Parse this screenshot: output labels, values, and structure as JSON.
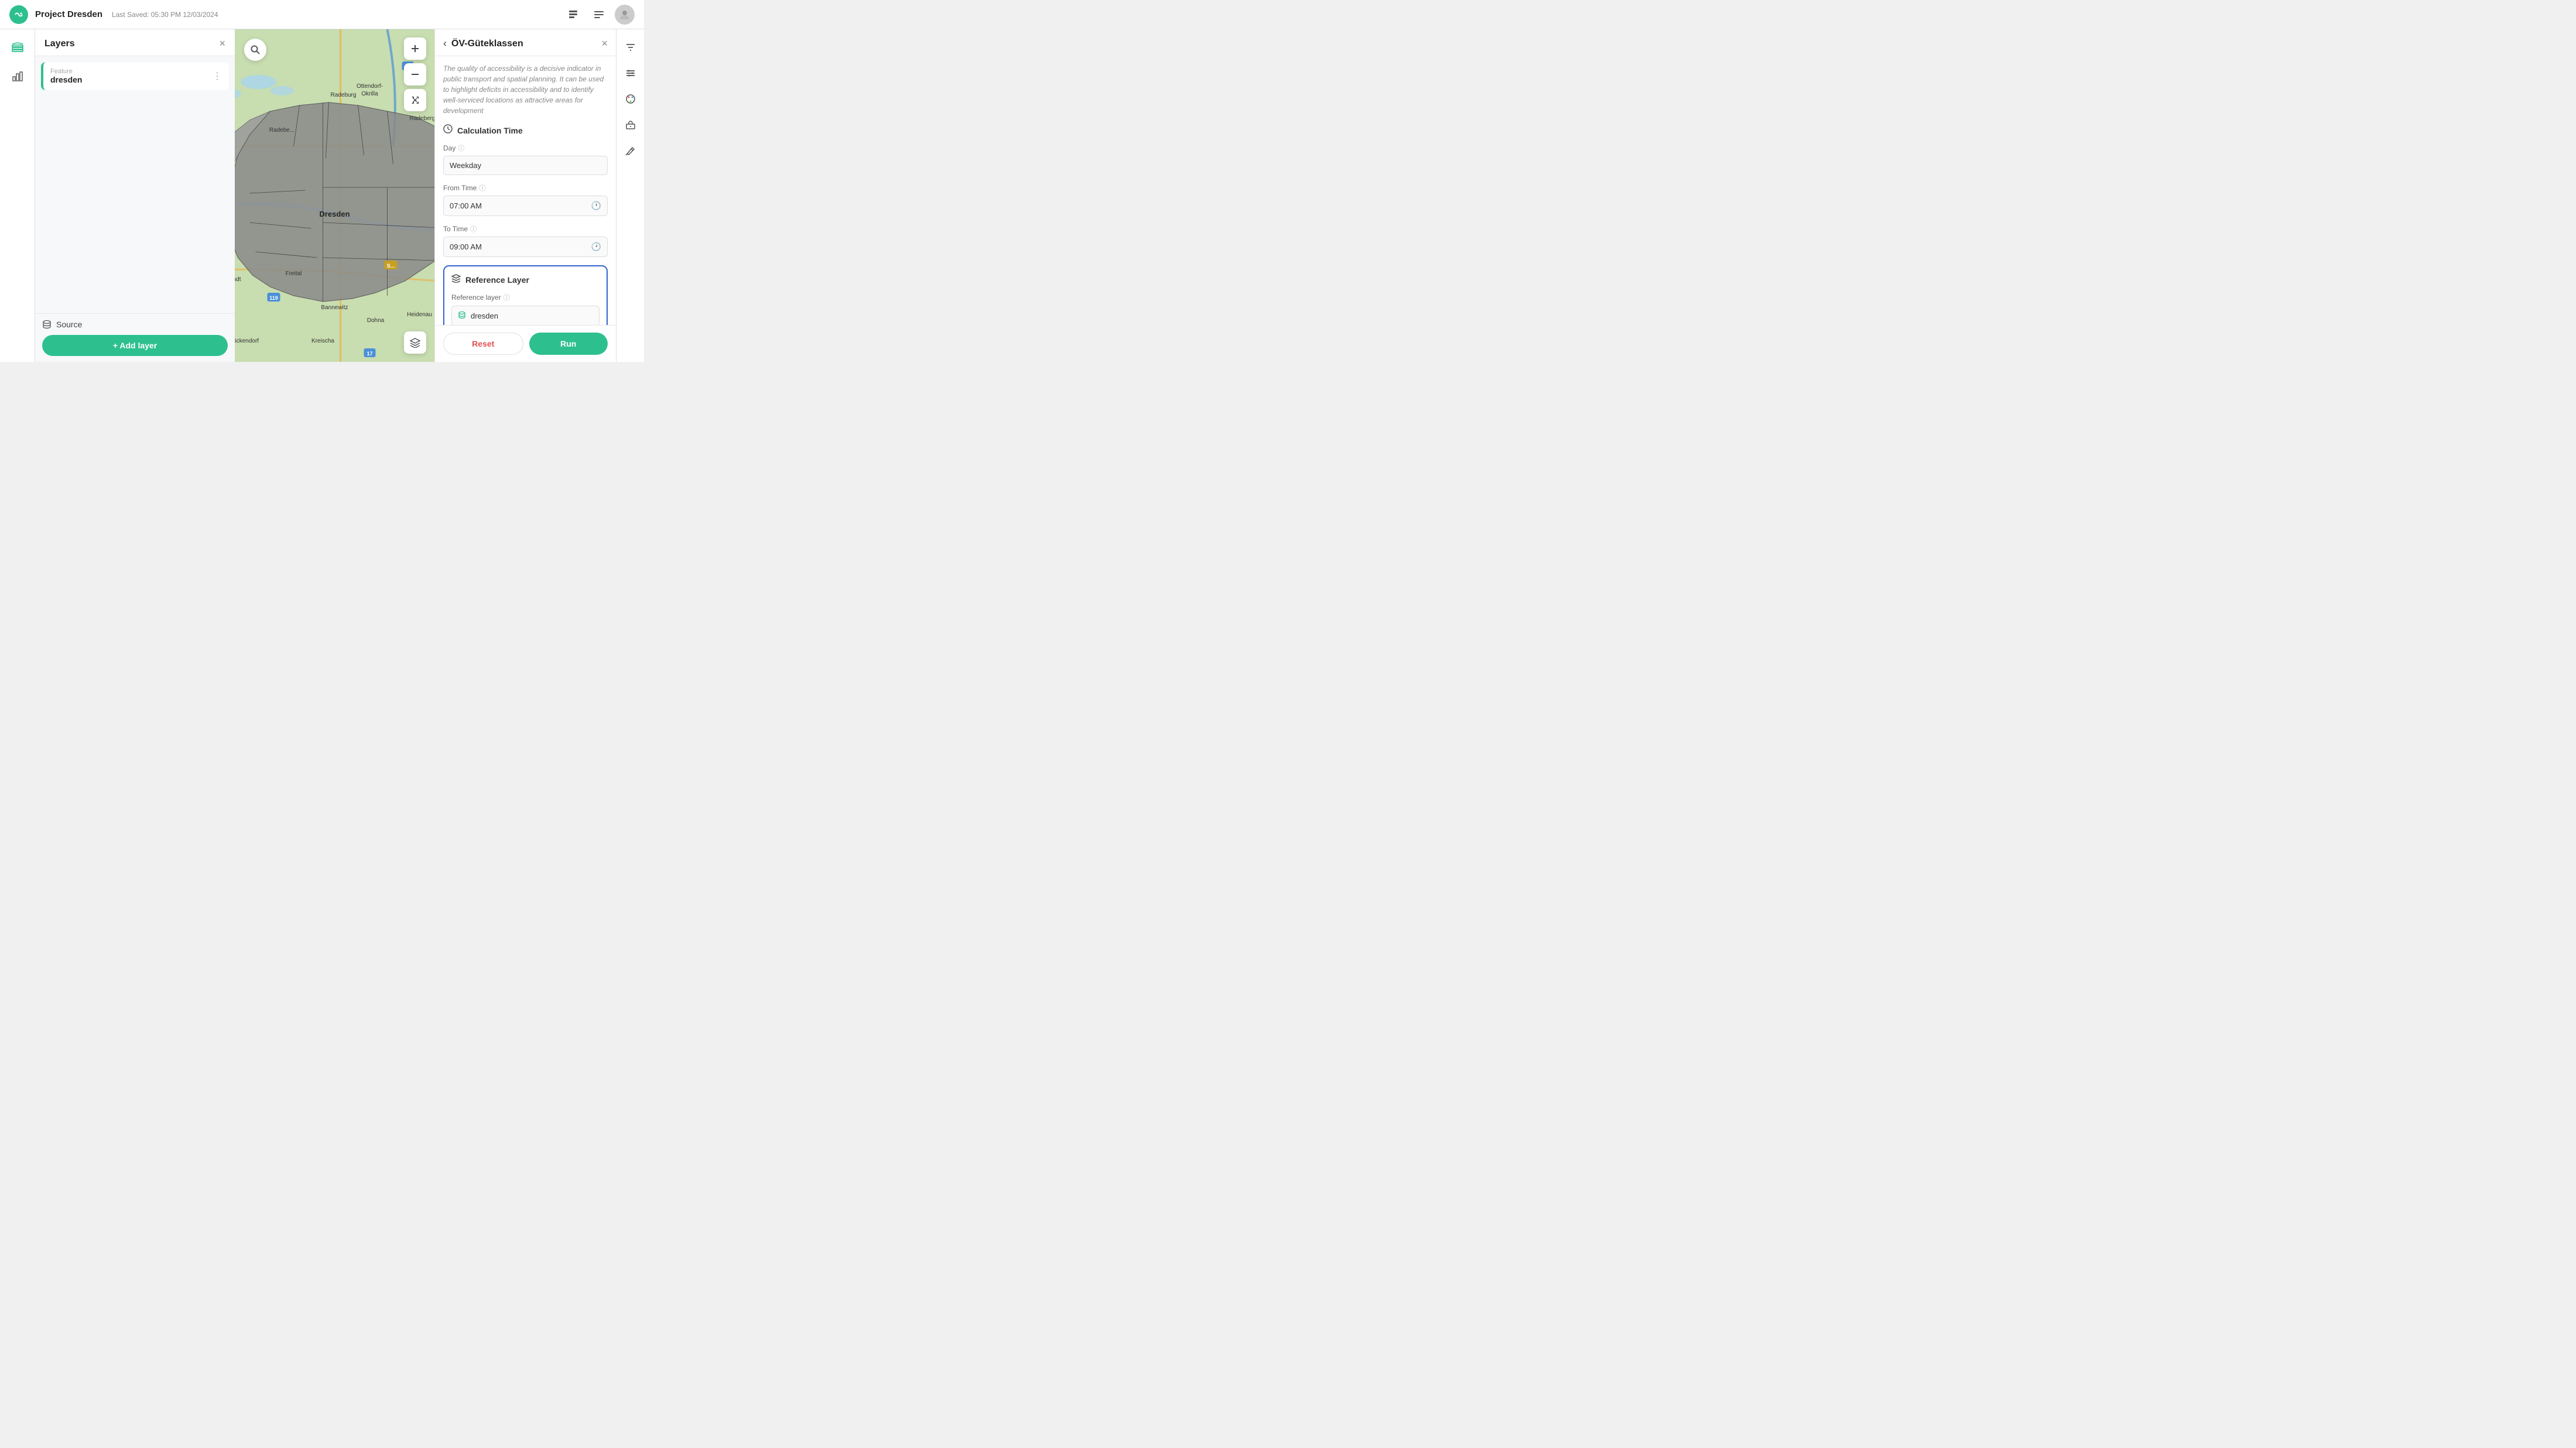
{
  "header": {
    "title": "Project Dresden",
    "last_saved": "Last Saved: 05:30 PM 12/03/2024",
    "logo_char": "🐠"
  },
  "sidebar": {
    "title": "Layers",
    "layers": [
      {
        "type": "Feature",
        "name": "dresden",
        "color": "#2dc08e"
      }
    ],
    "source_label": "Source",
    "add_layer_label": "+ Add layer"
  },
  "map": {
    "zoom_in": "+",
    "zoom_out": "−",
    "search_icon": "🔍"
  },
  "right_panel": {
    "title": "ÖV-Güteklassen",
    "description": "The quality of accessibility is a decisive indicator in public transport and spatial planning. It can be used to highlight deficits in accessibility and to identify well-serviced locations as attractive areas for development",
    "calculation_time": {
      "section_title": "Calculation Time",
      "day_label": "Day",
      "day_value": "Weekday",
      "from_time_label": "From Time",
      "from_time_value": "07:00 AM",
      "to_time_label": "To Time",
      "to_time_value": "09:00 AM"
    },
    "reference_layer": {
      "section_title": "Reference Layer",
      "layer_label": "Reference layer",
      "layer_value": "dresden"
    },
    "reset_label": "Reset",
    "run_label": "Run"
  },
  "right_toolbar": {
    "icons": [
      "≡",
      "⚡",
      "🎨",
      "📦",
      "✏️"
    ]
  }
}
